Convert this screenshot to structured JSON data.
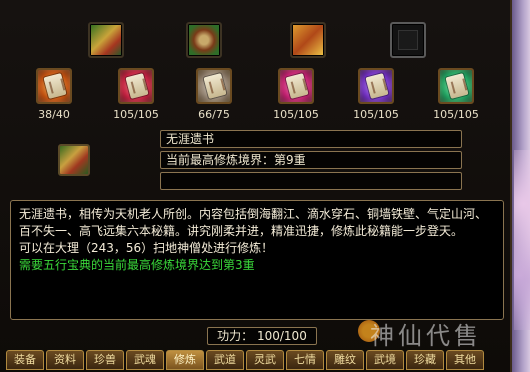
{
  "top_icons": [
    {
      "name": "book-green-icon"
    },
    {
      "name": "book-scroll-icon"
    },
    {
      "name": "book-gold-icon"
    },
    {
      "name": "empty-slot-icon"
    }
  ],
  "scrolls": [
    {
      "count": "38/40"
    },
    {
      "count": "105/105"
    },
    {
      "count": "66/75"
    },
    {
      "count": "105/105"
    },
    {
      "count": "105/105"
    },
    {
      "count": "105/105"
    }
  ],
  "book": {
    "name": "无涯遗书",
    "realm": "当前最高修炼境界：第9重",
    "extra": ""
  },
  "description": {
    "text": "无涯遗书，相传为天机老人所创。内容包括倒海翻江、滴水穿石、铜墙铁壁、气定山河、百不失一、高飞远集六本秘籍。讲究刚柔并进，精准迅捷，修炼此秘籍能一步登天。",
    "location": "可以在大理（243，56）扫地神僧处进行修炼！",
    "requirement": "需要五行宝典的当前最高修炼境界达到第3重"
  },
  "power": "功力：  100/100",
  "tabs": [
    "装备",
    "资料",
    "珍兽",
    "武魂",
    "修炼",
    "武道",
    "灵武",
    "七情",
    "雕纹",
    "武境",
    "珍藏",
    "其他"
  ],
  "active_tab": "修炼",
  "watermark": "神仙代售"
}
